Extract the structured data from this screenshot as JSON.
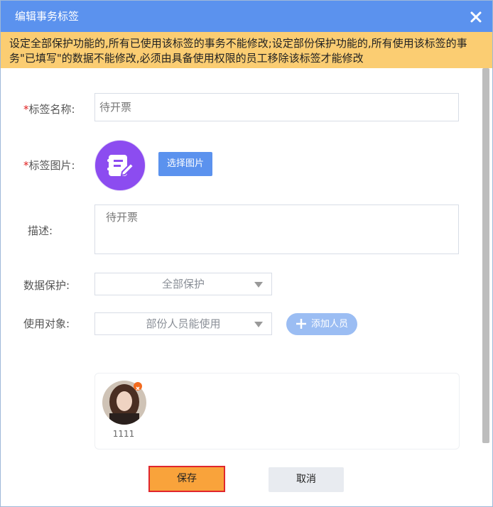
{
  "dialog": {
    "title": "编辑事务标签",
    "close_icon": "close-icon"
  },
  "warning": {
    "text": "设定全部保护功能的,所有已使用该标签的事务不能修改;设定部份保护功能的,所有使用该标签的事务\"已填写\"的数据不能修改,必须由具备使用权限的员工移除该标签才能修改"
  },
  "form": {
    "name_label": "标签名称:",
    "name_value": "待开票",
    "image_label": "标签图片:",
    "choose_image_label": "选择图片",
    "tag_icon": "note-edit-icon",
    "desc_label": "描述:",
    "desc_value": "待开票",
    "protection_label": "数据保护:",
    "protection_value": "全部保护",
    "target_label": "使用对象:",
    "target_value": "部份人员能使用",
    "add_member_label": "添加人员",
    "required_mark": "*"
  },
  "members": [
    {
      "name": "1111"
    }
  ],
  "footer": {
    "save_label": "保存",
    "cancel_label": "取消"
  },
  "colors": {
    "titlebar": "#5b92ee",
    "warning_bg": "#fbcd72",
    "primary": "#5b92ee",
    "tag_icon_bg": "#8c4cf0",
    "save_bg": "#f9a33b",
    "save_border": "#e0262d"
  }
}
